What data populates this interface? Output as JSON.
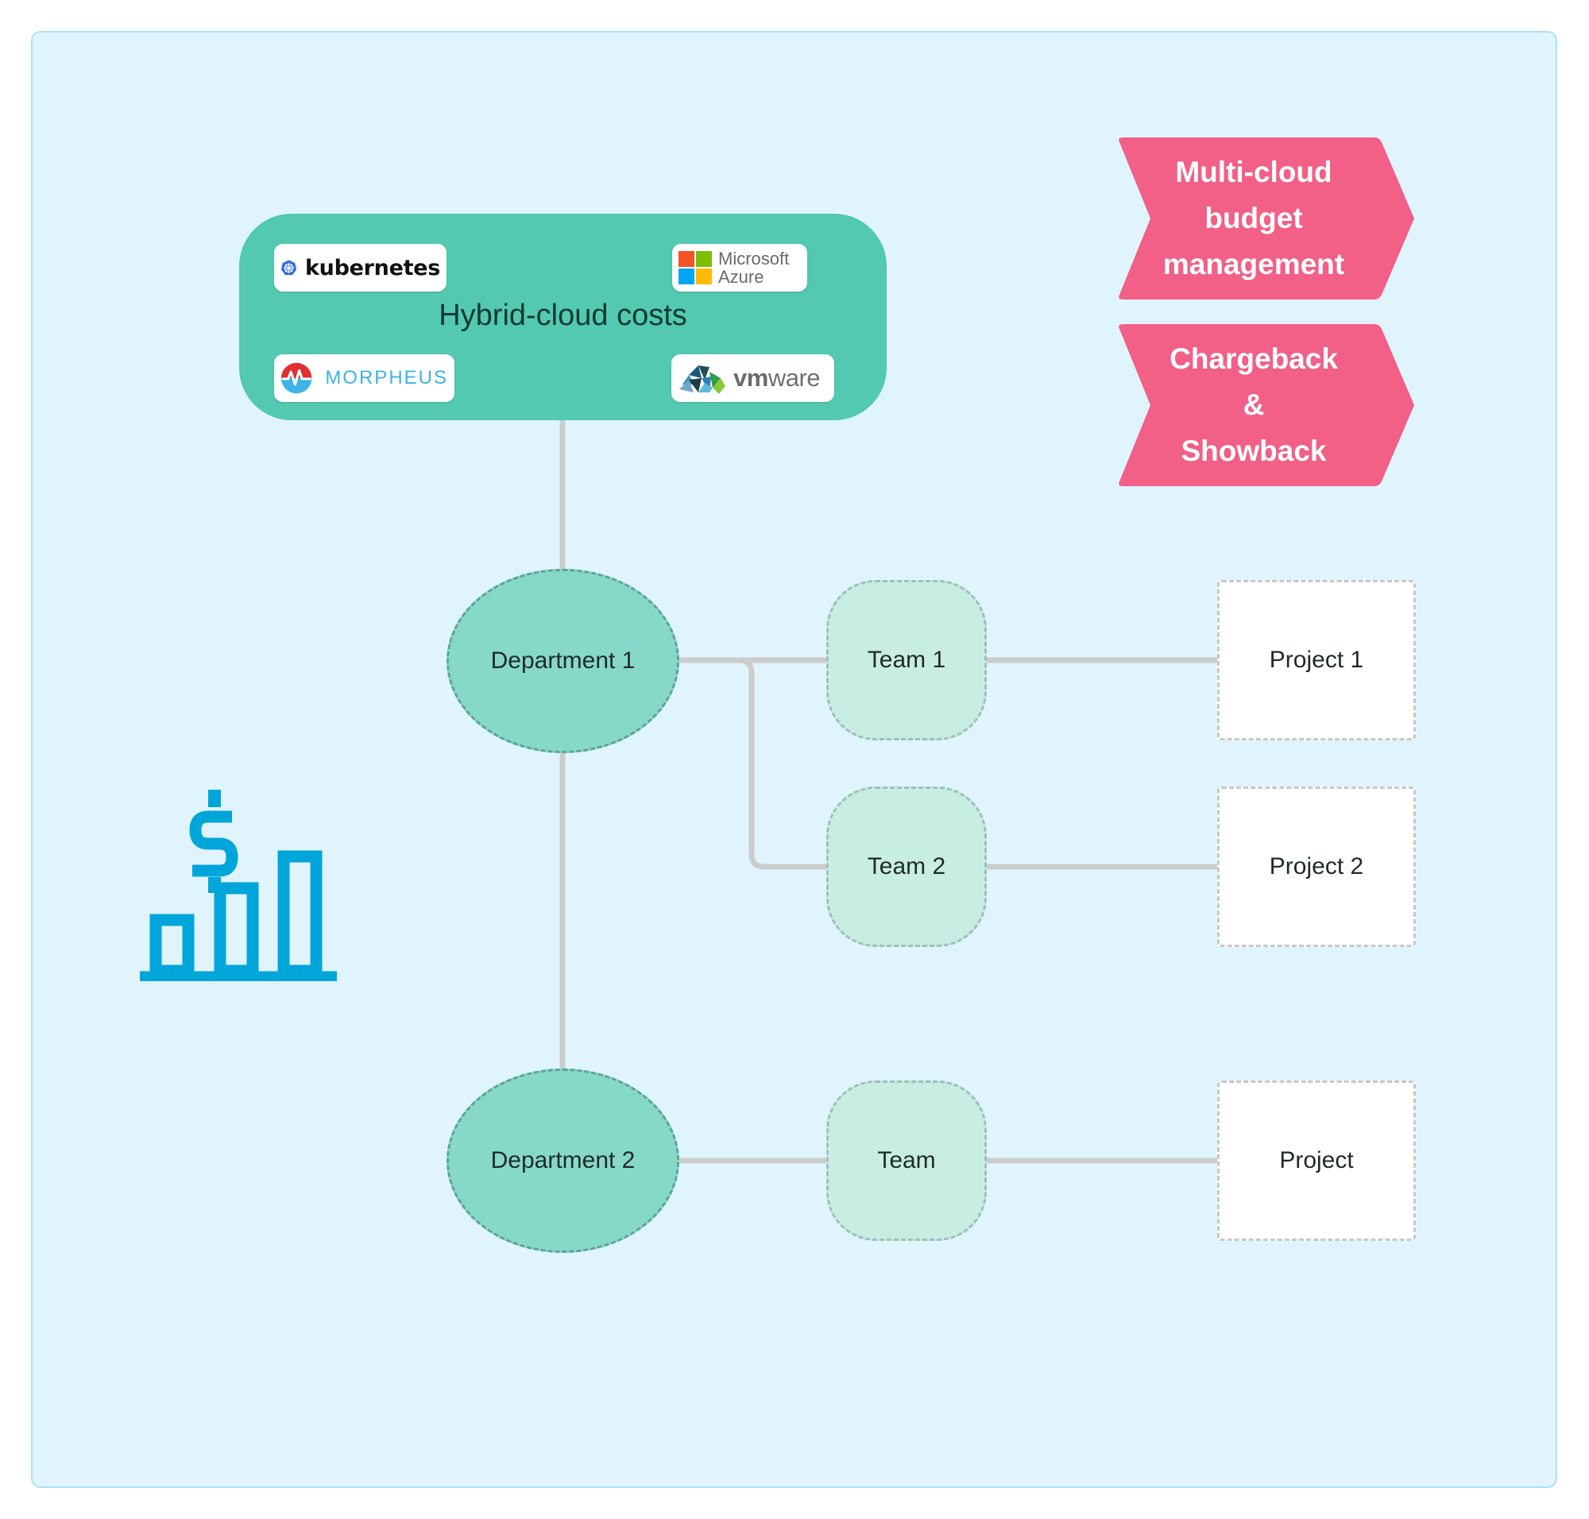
{
  "hub": {
    "title": "Hybrid-cloud costs",
    "logos": {
      "kubernetes": "kubernetes",
      "azure_line1": "Microsoft",
      "azure_line2": "Azure",
      "morpheus": "MORPHEUS",
      "vmware_bold": "vm",
      "vmware_rest": "ware"
    }
  },
  "chevrons": [
    {
      "lines": [
        "Multi-cloud",
        "budget",
        "management"
      ]
    },
    {
      "lines": [
        "Chargeback",
        "&",
        "Showback"
      ]
    }
  ],
  "departments": [
    {
      "label": "Department 1"
    },
    {
      "label": "Department 2"
    }
  ],
  "teams": [
    {
      "label": "Team 1"
    },
    {
      "label": "Team 2"
    },
    {
      "label": "Team"
    }
  ],
  "projects": [
    {
      "label": "Project 1"
    },
    {
      "label": "Project 2"
    },
    {
      "label": "Project"
    }
  ],
  "colors": {
    "background": "#e0f4fd",
    "hub": "#52c9b0",
    "chevron": "#f25f87",
    "department": "#86d9c9",
    "team": "#c8eee4",
    "project": "#ffffff",
    "connector": "#cccccc",
    "money_icon": "#00a6d9"
  },
  "icons": {
    "money_chart": "dollar-bar-chart-icon"
  }
}
